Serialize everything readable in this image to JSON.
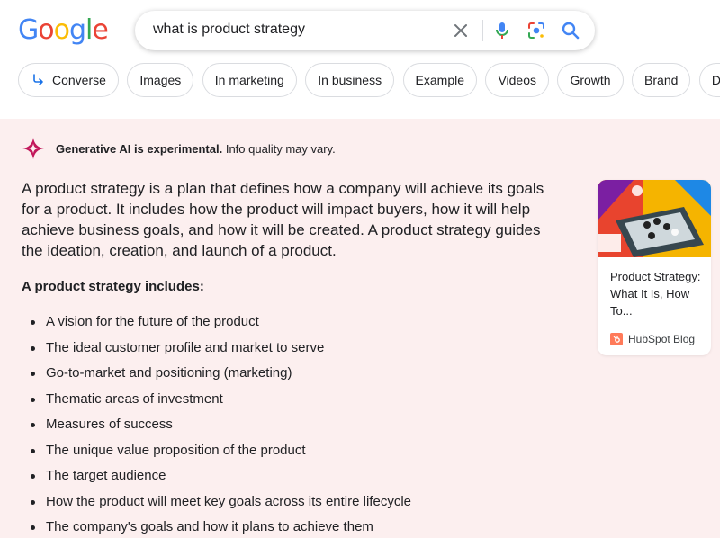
{
  "logo": {
    "letters": [
      "G",
      "o",
      "o",
      "g",
      "l",
      "e"
    ],
    "colors": [
      "#4285F4",
      "#EA4335",
      "#FBBC05",
      "#4285F4",
      "#34A853",
      "#EA4335"
    ]
  },
  "search": {
    "query": "what is product strategy"
  },
  "chips": [
    {
      "label": "Converse",
      "icon": "converse-arrow-icon"
    },
    {
      "label": "Images"
    },
    {
      "label": "In marketing"
    },
    {
      "label": "In business"
    },
    {
      "label": "Example"
    },
    {
      "label": "Videos"
    },
    {
      "label": "Growth"
    },
    {
      "label": "Brand"
    },
    {
      "label": "Differenti"
    }
  ],
  "sge": {
    "notice_bold": "Generative AI is experimental.",
    "notice_rest": " Info quality may vary.",
    "summary": "A product strategy is a plan that defines how a company will achieve its goals for a product. It includes how the product will impact buyers, how it will help achieve business goals, and how it will be created. A product strategy guides the ideation, creation, and launch of a product.",
    "includes_title": "A product strategy includes:",
    "bullets": [
      "A vision for the future of the product",
      "The ideal customer profile and market to serve",
      "Go-to-market and positioning (marketing)",
      "Thematic areas of investment",
      "Measures of success",
      "The unique value proposition of the product",
      "The target audience",
      "How the product will meet key goals across its entire lifecycle",
      "The company's goals and how it plans to achieve them"
    ]
  },
  "source_card": {
    "title": "Product Strategy: What It Is, How To...",
    "source": "HubSpot Blog"
  },
  "colors": {
    "panel_bg": "#fcefef",
    "gen_icon": "#c2185b",
    "search_blue": "#4285F4"
  }
}
